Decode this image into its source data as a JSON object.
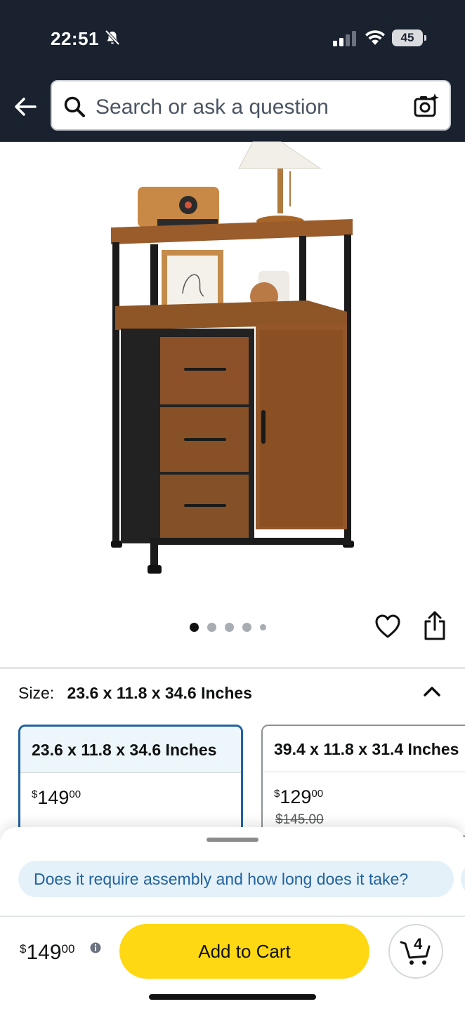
{
  "status_bar": {
    "time": "22:51",
    "battery": "45"
  },
  "header": {
    "search_placeholder": "Search or ask a question"
  },
  "carousel": {
    "total_dots": 5,
    "active_index": 0
  },
  "size": {
    "label": "Size:",
    "selected_value": "23.6 x 11.8 x 34.6 Inches",
    "options": [
      {
        "title": "23.6 x 11.8 x 34.6 Inches",
        "price_currency": "$",
        "price_whole": "149",
        "price_fraction": "00",
        "old_price": ""
      },
      {
        "title": "39.4 x 11.8 x 31.4 Inches",
        "price_currency": "$",
        "price_whole": "129",
        "price_fraction": "00",
        "old_price": "$145.00"
      }
    ]
  },
  "sheet": {
    "question": "Does it require assembly and how long does it take?",
    "price_currency": "$",
    "price_whole": "149",
    "price_fraction": "00",
    "add_to_cart_label": "Add to Cart",
    "cart_count": "4"
  },
  "colors": {
    "header_bg": "#1a2230",
    "accent_blue": "#2162a1",
    "add_to_cart_yellow": "#ffd814",
    "question_bg": "#e4f1f8"
  }
}
